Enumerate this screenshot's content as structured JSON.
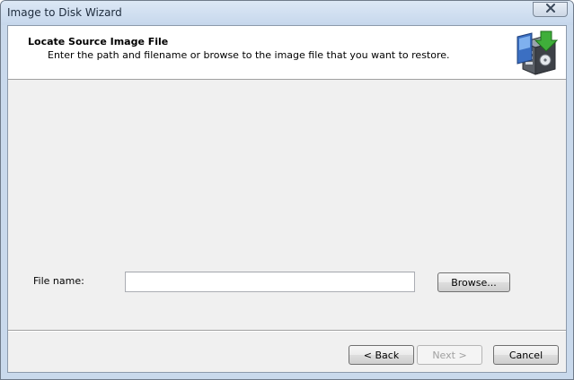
{
  "window": {
    "title": "Image to Disk Wizard",
    "close_icon": "close-icon"
  },
  "header": {
    "title": "Locate Source Image File",
    "subtitle": "Enter the path and filename or browse to the image file that you want to restore.",
    "icon": "disk-image-restore-icon"
  },
  "form": {
    "file_name_label": "File name:",
    "file_name_value": "",
    "browse_label": "Browse..."
  },
  "footer": {
    "back_label": "< Back",
    "next_label": "Next >",
    "cancel_label": "Cancel",
    "next_enabled": false
  },
  "colors": {
    "titlebar": "#c6d7ec",
    "client_background": "#f0f0f0",
    "header_background": "#ffffff"
  }
}
